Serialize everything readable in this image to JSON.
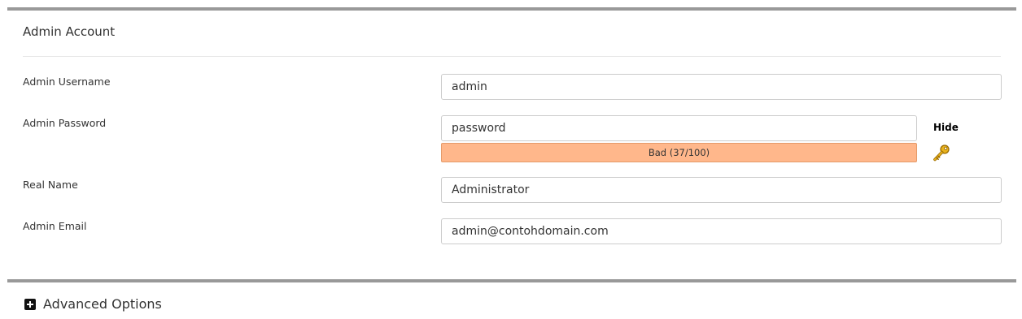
{
  "admin_account": {
    "title": "Admin Account",
    "username": {
      "label": "Admin Username",
      "value": "admin"
    },
    "password": {
      "label": "Admin Password",
      "value": "password",
      "strength_text": "Bad (37/100)",
      "strength_score": 37,
      "toggle_label": "Hide",
      "generate_icon": "key-icon"
    },
    "real_name": {
      "label": "Real Name",
      "value": "Administrator"
    },
    "email": {
      "label": "Admin Email",
      "value": "admin@contohdomain.com"
    }
  },
  "advanced_options": {
    "label": "Advanced Options",
    "icon": "plus-square-icon"
  },
  "colors": {
    "section_border": "#999999",
    "strength_bad_fill": "#ffb78b",
    "strength_bad_border": "#e59a69"
  }
}
